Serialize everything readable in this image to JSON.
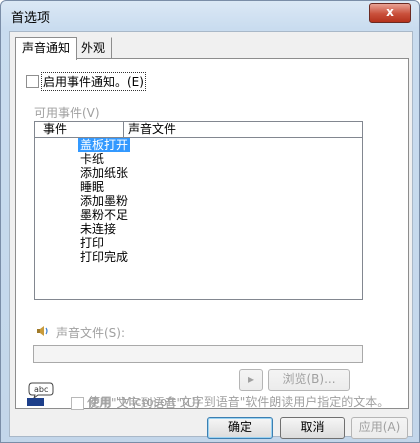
{
  "window": {
    "title": "首选项",
    "close_label": "x"
  },
  "tabs": [
    {
      "label": "声音通知"
    },
    {
      "label": "外观"
    }
  ],
  "enable": {
    "label": "启用事件通知。(E)"
  },
  "events": {
    "heading": "可用事件(V)",
    "columns": {
      "event": "事件",
      "sound_file": "声音文件"
    },
    "items": [
      "盖板打开",
      "卡纸",
      "添加纸张",
      "睡眠",
      "添加墨粉",
      "墨粉不足",
      "未连接",
      "打印",
      "打印完成"
    ],
    "selected_index": 0
  },
  "sound": {
    "label": "声音文件(S):",
    "file_value": "",
    "play_label": "▸",
    "browse_label": "浏览(B)..."
  },
  "tts": {
    "icon_text": "abc",
    "label": "使用\"文字到语音\"(U)",
    "description": "使用 \"Microsoft 文字到语音\"软件朗读用户指定的文本。"
  },
  "buttons": {
    "ok": "确定",
    "cancel": "取消",
    "apply": "应用(A)"
  },
  "colors": {
    "selection": "#3399ff",
    "disabled_text": "#a0a0a0"
  }
}
